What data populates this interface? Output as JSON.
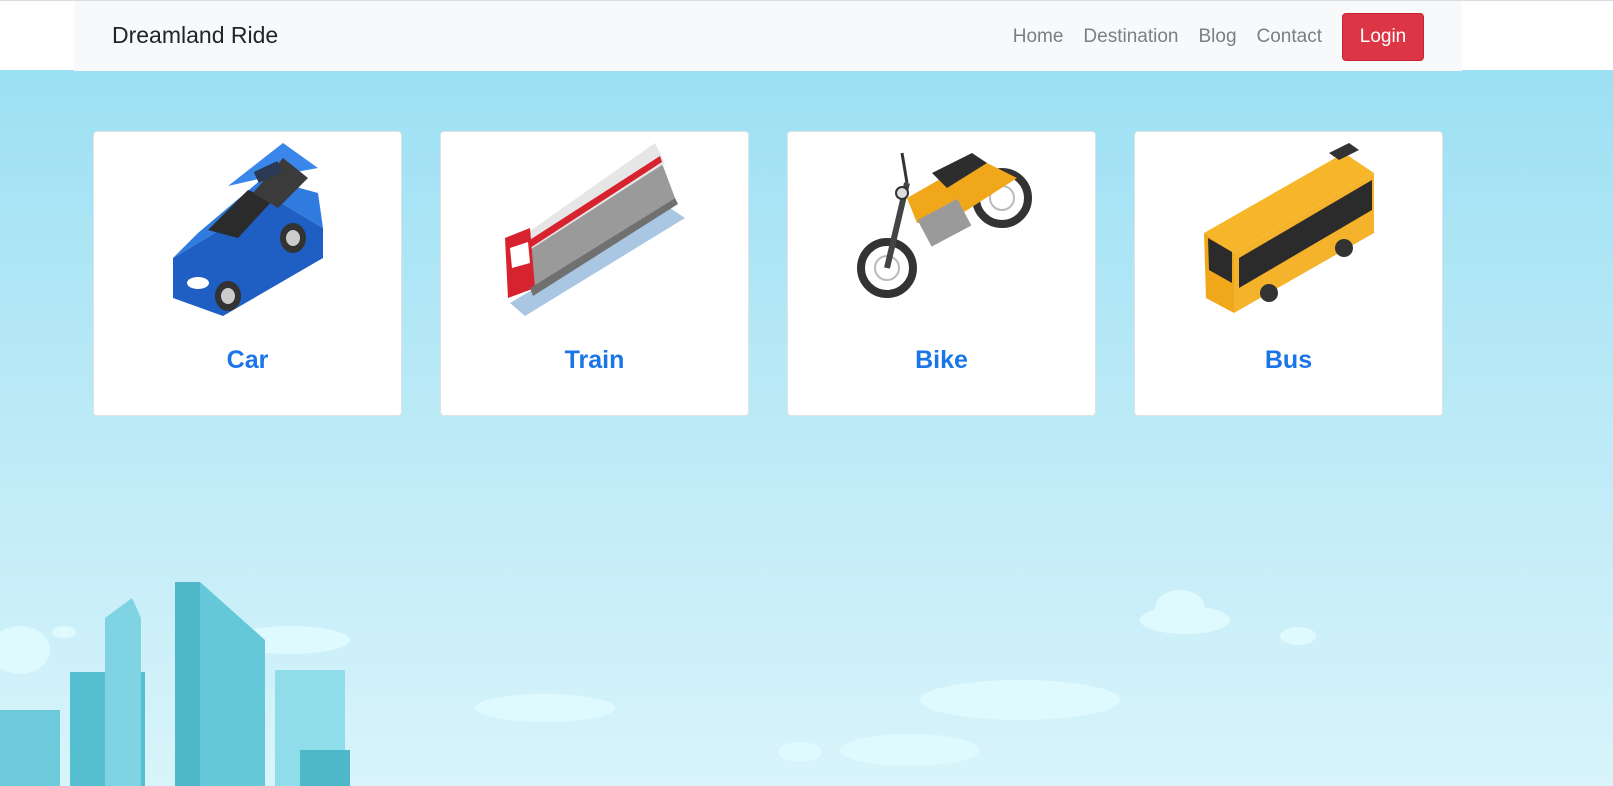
{
  "navbar": {
    "brand": "Dreamland Ride",
    "links": [
      "Home",
      "Destination",
      "Blog",
      "Contact"
    ],
    "login_label": "Login"
  },
  "vehicles": [
    {
      "title": "Car",
      "icon": "car-icon"
    },
    {
      "title": "Train",
      "icon": "train-icon"
    },
    {
      "title": "Bike",
      "icon": "motorbike-icon"
    },
    {
      "title": "Bus",
      "icon": "bus-icon"
    }
  ],
  "colors": {
    "accent": "#1a75e8",
    "login": "#dc3545",
    "sky": "#95def3"
  }
}
